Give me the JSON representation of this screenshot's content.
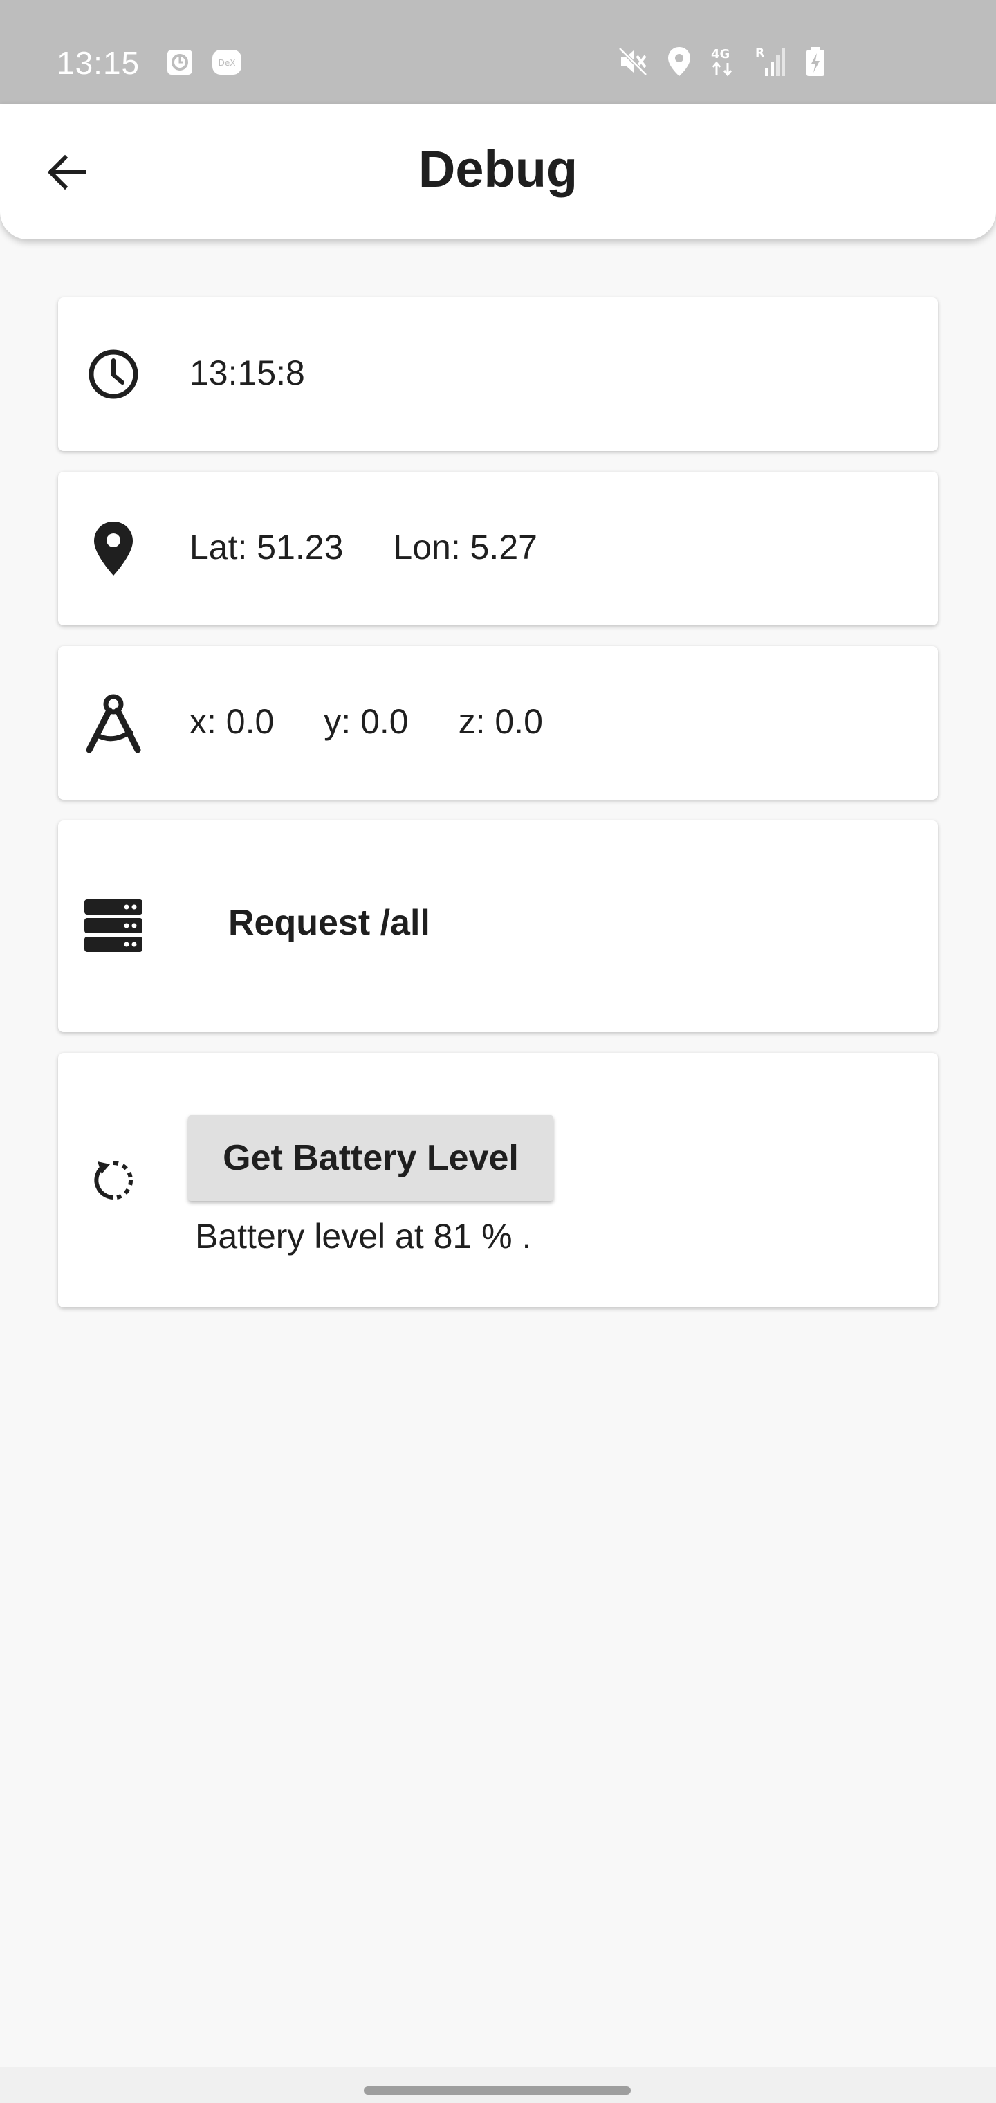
{
  "status_bar": {
    "time": "13:15",
    "left_icons": [
      "clock-notification-icon",
      "dex-icon"
    ],
    "dex_label": "DeX",
    "right_icons": [
      "mute-icon",
      "location-icon",
      "network-4g-icon",
      "signal-roaming-icon",
      "battery-charging-icon"
    ],
    "network_label": "4G",
    "roaming_label": "R"
  },
  "app_bar": {
    "title": "Debug",
    "back_icon": "arrow-back-icon"
  },
  "cards": {
    "time": {
      "icon": "clock-icon",
      "value": "13:15:8"
    },
    "location": {
      "icon": "location-pin-icon",
      "lat": "Lat: 51.23",
      "lon": "Lon: 5.27"
    },
    "accelerometer": {
      "icon": "compass-drafting-icon",
      "x": "x: 0.0",
      "y": "y: 0.0",
      "z": "z: 0.0"
    },
    "request": {
      "icon": "server-icon",
      "label": "Request /all"
    },
    "battery": {
      "icon": "refresh-icon",
      "button_label": "Get Battery Level",
      "status": "Battery level at 81 % ."
    }
  },
  "colors": {
    "status_bar": "#bdbdbd",
    "background": "#f8f8f8",
    "card": "#ffffff",
    "button": "#e0e0e0",
    "text": "#1f1f1f"
  }
}
